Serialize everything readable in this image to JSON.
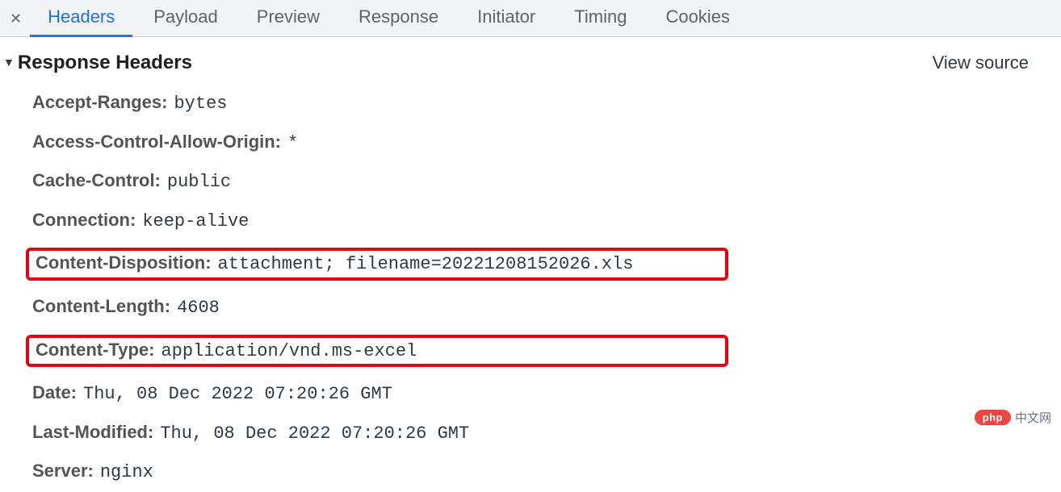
{
  "tabs": {
    "headers": "Headers",
    "payload": "Payload",
    "preview": "Preview",
    "response": "Response",
    "initiator": "Initiator",
    "timing": "Timing",
    "cookies": "Cookies"
  },
  "section": {
    "title": "Response Headers",
    "view_source": "View source"
  },
  "headers": {
    "accept_ranges": {
      "k": "Accept-Ranges:",
      "v": "bytes"
    },
    "acao": {
      "k": "Access-Control-Allow-Origin:",
      "v": "*"
    },
    "cache_control": {
      "k": "Cache-Control:",
      "v": "public"
    },
    "connection": {
      "k": "Connection:",
      "v": "keep-alive"
    },
    "content_disposition": {
      "k": "Content-Disposition:",
      "v": "attachment; filename=20221208152026.xls"
    },
    "content_length": {
      "k": "Content-Length:",
      "v": "4608"
    },
    "content_type": {
      "k": "Content-Type:",
      "v": "application/vnd.ms-excel"
    },
    "date": {
      "k": "Date:",
      "v": "Thu, 08 Dec 2022 07:20:26 GMT"
    },
    "last_modified": {
      "k": "Last-Modified:",
      "v": "Thu, 08 Dec 2022 07:20:26 GMT"
    },
    "server": {
      "k": "Server:",
      "v": "nginx"
    }
  },
  "badge": {
    "pill": "php",
    "text": "中文网"
  }
}
